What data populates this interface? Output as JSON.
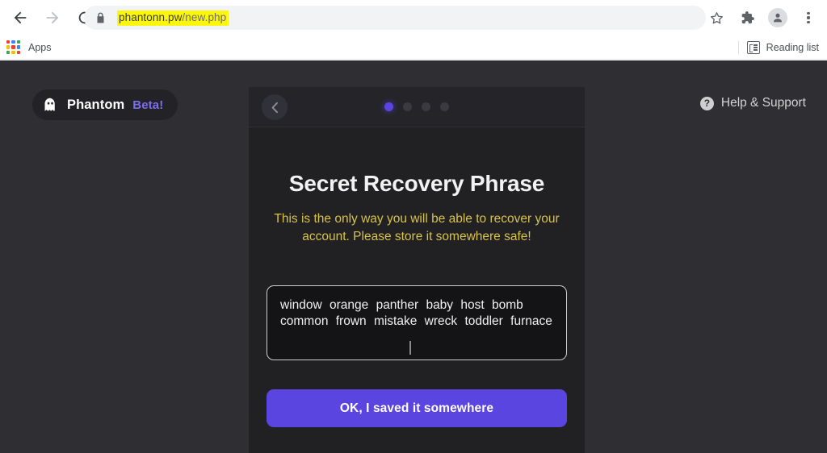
{
  "browser": {
    "back_label": "Back",
    "forward_label": "Forward",
    "reload_label": "Reload",
    "lock_label": "View site information",
    "url_host": "phantonn.pw",
    "url_path": "/new.php",
    "url_full": "phantonn.pw/new.php",
    "bookmark_label": "Bookmark this tab",
    "extensions_label": "Extensions",
    "profile_label": "Profile",
    "menu_label": "Customize and control Google Chrome",
    "apps_label": "Apps",
    "reading_list_label": "Reading list"
  },
  "page": {
    "brand": {
      "name": "Phantom",
      "beta": "Beta!"
    },
    "help": {
      "icon": "question-circle-icon",
      "label": "Help & Support"
    }
  },
  "modal": {
    "back_icon": "chevron-left-icon",
    "steps": {
      "total": 4,
      "active": 1
    },
    "title": "Secret Recovery Phrase",
    "warning": "This is the only way you will be able to recover your account. Please store it somewhere safe!",
    "seed_words": [
      "window",
      "orange",
      "panther",
      "baby",
      "host",
      "bomb",
      "common",
      "frown",
      "mistake",
      "wreck",
      "toddler",
      "furnace"
    ],
    "seed_phrase": "window orange panther baby host bomb common frown mistake wreck toddler furnace",
    "cta_label": "OK, I saved it somewhere"
  },
  "colors": {
    "accent_purple": "#5b45e0",
    "beta_purple": "#7b6ef0",
    "warning_yellow": "#d8c24a",
    "page_bg": "#2e2e33",
    "modal_bg": "#212124",
    "highlight_yellow": "#fbf60a"
  }
}
